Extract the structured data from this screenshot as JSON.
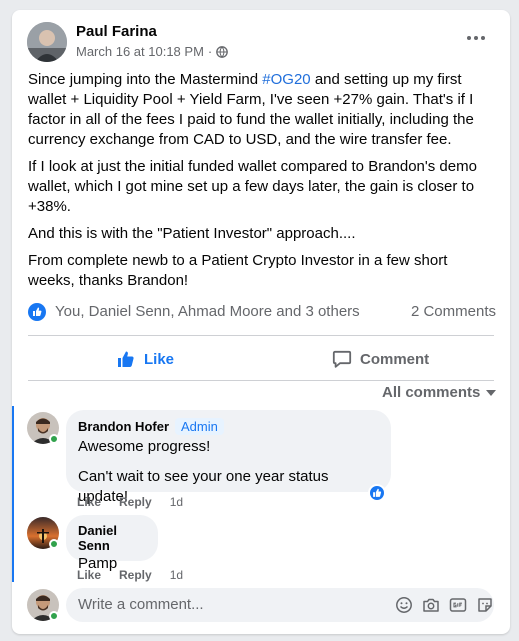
{
  "post": {
    "author": "Paul Farina",
    "timestamp": "March 16 at 10:18 PM",
    "meta_separator": "·",
    "privacy_icon": "globe-icon",
    "body_part1": "Since jumping into the Mastermind ",
    "hashtag": "#OG20",
    "body_part2": " and setting up my first wallet + Liquidity Pool + Yield Farm, I've seen +27% gain. That's if I factor in all of the fees I paid to fund the wallet initially, including the currency exchange from CAD to USD, and the wire transfer fee.",
    "paragraph2": "If I look at just the initial funded wallet compared to Brandon's demo wallet, which I got mine set up a few days later,  the gain is closer to +38%.",
    "paragraph3": "And this is with the \"Patient Investor\" approach....",
    "paragraph4": "From complete newb to a Patient Crypto Investor in a few short weeks, thanks Brandon!"
  },
  "reactions": {
    "names": "You, Daniel Senn, Ahmad Moore and 3 others",
    "comments_count": "2 Comments"
  },
  "actions": {
    "like_label": "Like",
    "comment_label": "Comment"
  },
  "comments_filter": "All comments",
  "comments": [
    {
      "name": "Brandon Hofer",
      "badge": "Admin",
      "line1": "Awesome progress!",
      "line2": "Can't wait to see your one year status update!",
      "like_label": "Like",
      "reply_label": "Reply",
      "age": "1d"
    },
    {
      "name": "Daniel Senn",
      "line1": "Pamp",
      "like_label": "Like",
      "reply_label": "Reply",
      "age": "1d"
    }
  ],
  "composer": {
    "placeholder": "Write a comment..."
  },
  "colors": {
    "accent": "#1877f2",
    "hashtag": "#216fdb",
    "online": "#31a24c"
  }
}
